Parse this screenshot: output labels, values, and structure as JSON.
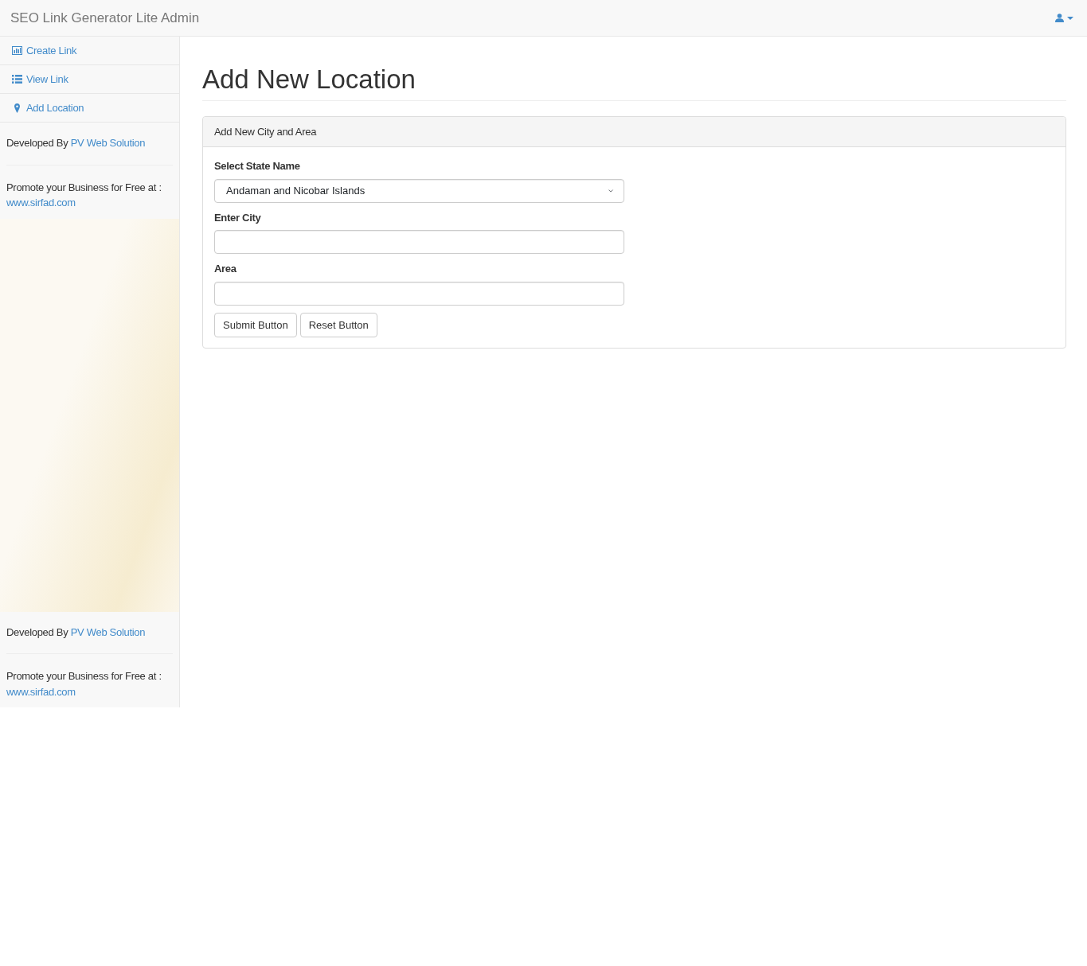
{
  "navbar": {
    "brand": "SEO Link Generator Lite Admin"
  },
  "sidebar": {
    "items": [
      {
        "label": "Create Link"
      },
      {
        "label": "View Link"
      },
      {
        "label": "Add Location"
      }
    ],
    "credits": [
      {
        "developed_by": "Developed By",
        "developer_link": "PV Web Solution",
        "promote_text": "Promote your Business for Free at :",
        "promote_link": "www.sirfad.com"
      },
      {
        "developed_by": "Developed By",
        "developer_link": "PV Web Solution",
        "promote_text": "Promote your Business for Free at :",
        "promote_link": "www.sirfad.com"
      }
    ]
  },
  "page_title": "Add New Location",
  "panel": {
    "heading": "Add New City and Area",
    "fields": [
      {
        "kind": "select",
        "label": "Select State Name",
        "value": "Andaman and Nicobar Islands"
      },
      {
        "kind": "text",
        "label": "Enter City"
      },
      {
        "kind": "text",
        "label": "Area"
      }
    ],
    "buttons": [
      "Submit Button",
      "Reset Button"
    ]
  }
}
